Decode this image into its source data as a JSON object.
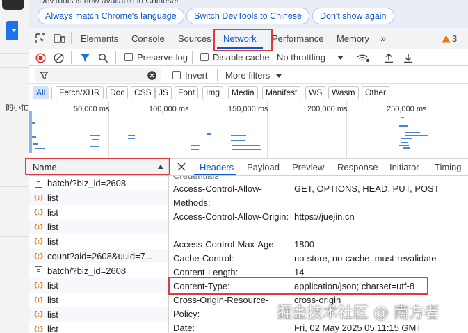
{
  "page_fragment": "的小忙",
  "infobar": {
    "message": "DevTools is now available in Chinese!",
    "buttons": [
      "Always match Chrome's language",
      "Switch DevTools to Chinese",
      "Don't show again"
    ]
  },
  "main_tabs": [
    "Elements",
    "Console",
    "Sources",
    "Network",
    "Performance",
    "Memory"
  ],
  "active_main_tab": "Network",
  "warning_count": "3",
  "toolbar": {
    "preserve_log": "Preserve log",
    "disable_cache": "Disable cache",
    "throttling": "No throttling"
  },
  "filter": {
    "invert": "Invert",
    "more_filters": "More filters"
  },
  "type_filters": [
    "All",
    "Fetch/XHR",
    "Doc",
    "CSS",
    "JS",
    "Font",
    "Img",
    "Media",
    "Manifest",
    "WS",
    "Wasm",
    "Other"
  ],
  "active_type_filter": "All",
  "overview_ticks": [
    "50,000 ms",
    "100,000 ms",
    "150,000 ms",
    "200,000 ms",
    "250,000 ms"
  ],
  "request_list": {
    "column_header": "Name",
    "requests": [
      {
        "name": "batch/?biz_id=2608",
        "icon": "document-icon"
      },
      {
        "name": "list",
        "icon": "json-icon"
      },
      {
        "name": "list",
        "icon": "json-icon"
      },
      {
        "name": "list",
        "icon": "json-icon"
      },
      {
        "name": "list",
        "icon": "json-icon"
      },
      {
        "name": "count?aid=2608&uuid=7...",
        "icon": "json-icon"
      },
      {
        "name": "batch/?biz_id=2608",
        "icon": "document-icon"
      },
      {
        "name": "list",
        "icon": "json-icon"
      },
      {
        "name": "list",
        "icon": "json-icon"
      },
      {
        "name": "list",
        "icon": "json-icon"
      },
      {
        "name": "list",
        "icon": "json-icon"
      }
    ]
  },
  "detail_tabs": [
    "Headers",
    "Payload",
    "Preview",
    "Response",
    "Initiator",
    "Timing"
  ],
  "active_detail_tab": "Headers",
  "response_headers": {
    "partial_top": "Credentials:",
    "rows": [
      {
        "key": "Access-Control-Allow-Methods:",
        "value": "GET, OPTIONS, HEAD, PUT, POST"
      },
      {
        "key": "Access-Control-Allow-Origin:",
        "value": "https://juejin.cn"
      },
      {
        "key": "Access-Control-Max-Age:",
        "value": "1800"
      },
      {
        "key": "Cache-Control:",
        "value": "no-store, no-cache, must-revalidate"
      },
      {
        "key": "Content-Length:",
        "value": "14"
      },
      {
        "key": "Content-Type:",
        "value": "application/json; charset=utf-8"
      },
      {
        "key": "Cross-Origin-Resource-Policy:",
        "value": "cross-origin"
      },
      {
        "key": "Date:",
        "value": "Fri, 02 May 2025 05:11:15 GMT"
      }
    ]
  },
  "watermark": "掘金技术社区 @ 南方者",
  "colors": {
    "accent": "#0b57d0",
    "highlight": "#e03a3a",
    "warning": "#e8710a"
  }
}
